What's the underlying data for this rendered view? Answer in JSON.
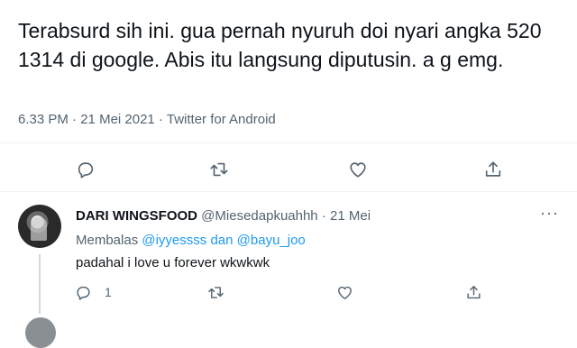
{
  "tweet": {
    "text": "Terabsurd sih ini. gua pernah nyuruh doi nyari angka 520 1314 di google. Abis itu langsung diputusin. a g emg.",
    "time": "6.33 PM",
    "separator": "·",
    "date": "21 Mei 2021",
    "source": "Twitter for Android"
  },
  "actions": {
    "reply_icon": "reply-icon",
    "retweet_icon": "retweet-icon",
    "like_icon": "like-icon",
    "share_icon": "share-icon"
  },
  "reply": {
    "name": "DARI WINGSFOOD",
    "handle": "@Miesedapkuahhh",
    "separator": "·",
    "date": "21 Mei",
    "more": "···",
    "replying_prefix": "Membalas",
    "replying_user1": "@iyyessss",
    "replying_and": "dan",
    "replying_user2": "@bayu_joo",
    "text": "padahal i love u forever wkwkwk",
    "reply_count": "1"
  },
  "colors": {
    "text": "#0f1419",
    "secondary": "#536471",
    "link": "#1d9bf0",
    "divider": "#eff3f4"
  }
}
